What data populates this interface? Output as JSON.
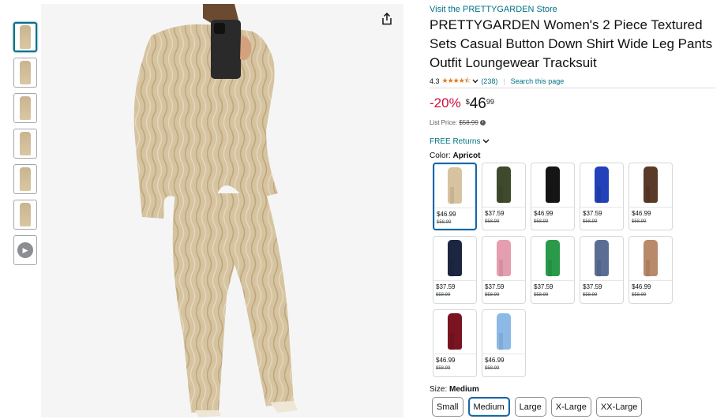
{
  "thumbnails": [
    {
      "name": "thumb-1",
      "selected": true
    },
    {
      "name": "thumb-2",
      "selected": false
    },
    {
      "name": "thumb-3",
      "selected": false
    },
    {
      "name": "thumb-4",
      "selected": false
    },
    {
      "name": "thumb-5",
      "selected": false
    },
    {
      "name": "thumb-6",
      "selected": false
    },
    {
      "name": "thumb-video",
      "selected": false,
      "video": true
    }
  ],
  "product": {
    "store_link": "Visit the PRETTYGARDEN Store",
    "title": "PRETTYGARDEN Women's 2 Piece Textured Sets Casual Button Down Shirt Wide Leg Pants Outfit Loungewear Tracksuit",
    "rating": "4.3",
    "stars": "★★★★⯪",
    "review_count": "(238)",
    "search_link": "Search this page",
    "discount": "-20%",
    "currency": "$",
    "price_whole": "46",
    "price_fraction": "99",
    "list_price_label": "List Price:",
    "list_price": "$58.99",
    "free_returns": "FREE Returns",
    "color_label": "Color:",
    "color_value": "Apricot",
    "size_label": "Size:",
    "size_value": "Medium"
  },
  "swatches": [
    {
      "color": "#d8c3a1",
      "price": "$46.99",
      "old": "$58.99",
      "selected": true
    },
    {
      "color": "#3e4a2c",
      "price": "$37.59",
      "old": "$58.99"
    },
    {
      "color": "#151515",
      "price": "$46.99",
      "old": "$58.99"
    },
    {
      "color": "#2341b8",
      "price": "$37.59",
      "old": "$58.99"
    },
    {
      "color": "#5a3b28",
      "price": "$46.99",
      "old": "$58.99"
    },
    {
      "color": "#1d2640",
      "price": "$37.59",
      "old": "$58.99"
    },
    {
      "color": "#e59db0",
      "price": "$37.59",
      "old": "$58.99"
    },
    {
      "color": "#2a9a4a",
      "price": "$37.59",
      "old": "$58.99"
    },
    {
      "color": "#5a6e94",
      "price": "$37.59",
      "old": "$58.99"
    },
    {
      "color": "#b98a69",
      "price": "$46.99",
      "old": "$58.99"
    },
    {
      "color": "#7a1420",
      "price": "$46.99",
      "old": "$58.99"
    },
    {
      "color": "#8cb9e6",
      "price": "$46.99",
      "old": "$58.99"
    }
  ],
  "sizes": [
    {
      "label": "Small"
    },
    {
      "label": "Medium",
      "selected": true
    },
    {
      "label": "Large"
    },
    {
      "label": "X-Large"
    },
    {
      "label": "XX-Large"
    }
  ],
  "colors": {
    "link": "#007185",
    "discount": "#cc0c39",
    "star": "#de7921",
    "selected_border": "#2162a1"
  }
}
